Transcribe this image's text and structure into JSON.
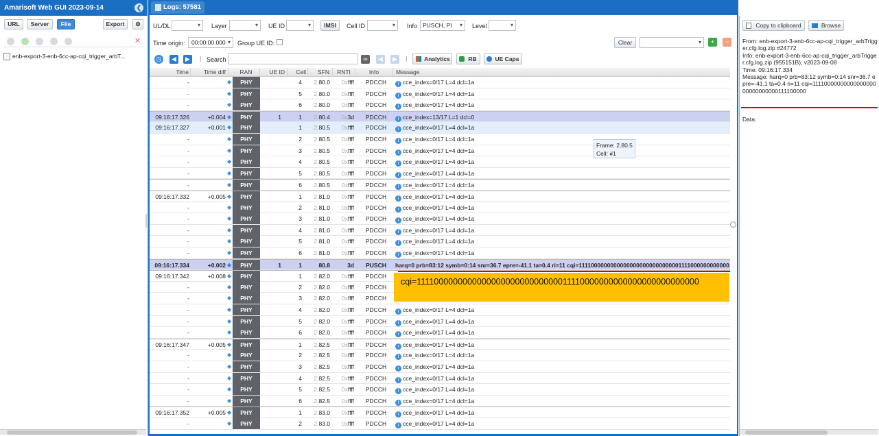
{
  "app": {
    "title": "Amarisoft Web GUI 2023-09-14"
  },
  "left": {
    "buttons": [
      "URL",
      "Server",
      "File",
      "Export"
    ],
    "tree_item": "enb-export-3-enb-6cc-ap-cqi_trigger_arbT..."
  },
  "main": {
    "tab_label": "Logs: 57581",
    "filters": {
      "uldl_label": "UL/DL",
      "uldl_value": "",
      "layer_label": "Layer",
      "layer_value": "",
      "ueid_label": "UE ID",
      "ueid_value": "",
      "imsi_button": "IMSI",
      "cellid_label": "Cell ID",
      "cellid_value": "",
      "info_label": "Info",
      "info_value": "PUSCH, PI",
      "level_label": "Level",
      "level_value": ""
    },
    "toolbar2": {
      "time_origin_label": "Time origin:",
      "time_origin_value": "00:00:00.000",
      "group_ueid_label": "Group UE ID:",
      "clear_button": "Clear",
      "clear_select_value": ""
    },
    "toolbar3": {
      "search_label": "Search",
      "analytics_button": "Analytics",
      "rb_button": "RB",
      "uecaps_button": "UE Caps"
    },
    "columns": [
      "Time",
      "Time diff",
      "RAN",
      "UE ID",
      "Cell",
      "SFN",
      "RNTI",
      "Info",
      "Message"
    ],
    "rows": [
      {
        "time": "-",
        "diff": "",
        "ran": "PHY",
        "ue": "",
        "cell": "4",
        "sfn_a": "2.",
        "sfn_b": "80.0",
        "rnti_a": "0x",
        "rnti_b": "ffff",
        "info": "PDCCH",
        "msg": "cce_index=0/17 L=4 dcl=1a",
        "style": ""
      },
      {
        "time": "-",
        "diff": "",
        "ran": "PHY",
        "ue": "",
        "cell": "5",
        "sfn_a": "2.",
        "sfn_b": "80.0",
        "rnti_a": "0x",
        "rnti_b": "ffff",
        "info": "PDCCH",
        "msg": "cce_index=0/17 L=4 dcl=1a",
        "style": ""
      },
      {
        "time": "-",
        "diff": "",
        "ran": "PHY",
        "ue": "",
        "cell": "6",
        "sfn_a": "2.",
        "sfn_b": "80.0",
        "rnti_a": "0x",
        "rnti_b": "ffff",
        "info": "PDCCH",
        "msg": "cce_index=0/17 L=4 dcl=1a",
        "style": ""
      },
      {
        "time": "09:16:17.326",
        "diff": "+0.004",
        "ran": "PHY",
        "ue": "1",
        "cell": "1",
        "sfn_a": "2.",
        "sfn_b": "80.4",
        "rnti_a": "0x",
        "rnti_b": "3d",
        "info": "PDCCH",
        "msg": "cce_index=13/17 L=1 dcl=0",
        "style": "hl sep"
      },
      {
        "time": "09:16:17.327",
        "diff": "+0.001",
        "ran": "PHY",
        "ue": "",
        "cell": "1",
        "sfn_a": "2.",
        "sfn_b": "80.5",
        "rnti_a": "0x",
        "rnti_b": "ffff",
        "info": "PDCCH",
        "msg": "cce_index=0/17 L=4 dcl=1a",
        "style": "hl2"
      },
      {
        "time": "-",
        "diff": "",
        "ran": "PHY",
        "ue": "",
        "cell": "2",
        "sfn_a": "2.",
        "sfn_b": "80.5",
        "rnti_a": "0x",
        "rnti_b": "ffff",
        "info": "PDCCH",
        "msg": "cce_index=0/17 L=4 dcl=1a",
        "style": ""
      },
      {
        "time": "-",
        "diff": "",
        "ran": "PHY",
        "ue": "",
        "cell": "3",
        "sfn_a": "2.",
        "sfn_b": "80.5",
        "rnti_a": "0x",
        "rnti_b": "ffff",
        "info": "PDCCH",
        "msg": "cce_index=0/17 L=4 dcl=1a",
        "style": ""
      },
      {
        "time": "-",
        "diff": "",
        "ran": "PHY",
        "ue": "",
        "cell": "4",
        "sfn_a": "2.",
        "sfn_b": "80.5",
        "rnti_a": "0x",
        "rnti_b": "ffff",
        "info": "PDCCH",
        "msg": "cce_index=0/17 L=4 dcl=1a",
        "style": ""
      },
      {
        "time": "-",
        "diff": "",
        "ran": "PHY",
        "ue": "",
        "cell": "5",
        "sfn_a": "2.",
        "sfn_b": "80.5",
        "rnti_a": "0x",
        "rnti_b": "ffff",
        "info": "PDCCH",
        "msg": "cce_index=0/17 L=4 dcl=1a",
        "style": ""
      },
      {
        "time": "-",
        "diff": "",
        "ran": "PHY",
        "ue": "",
        "cell": "6",
        "sfn_a": "2.",
        "sfn_b": "80.5",
        "rnti_a": "0x",
        "rnti_b": "ffff",
        "info": "PDCCH",
        "msg": "cce_index=0/17 L=4 dcl=1a",
        "style": "sep"
      },
      {
        "time": "09:16:17.332",
        "diff": "+0.005",
        "ran": "PHY",
        "ue": "",
        "cell": "1",
        "sfn_a": "2.",
        "sfn_b": "81.0",
        "rnti_a": "0x",
        "rnti_b": "ffff",
        "info": "PDCCH",
        "msg": "cce_index=0/17 L=4 dcl=1a",
        "style": "sep"
      },
      {
        "time": "-",
        "diff": "",
        "ran": "PHY",
        "ue": "",
        "cell": "2",
        "sfn_a": "2.",
        "sfn_b": "81.0",
        "rnti_a": "0x",
        "rnti_b": "ffff",
        "info": "PDCCH",
        "msg": "cce_index=0/17 L=4 dcl=1a",
        "style": ""
      },
      {
        "time": "-",
        "diff": "",
        "ran": "PHY",
        "ue": "",
        "cell": "3",
        "sfn_a": "2.",
        "sfn_b": "81.0",
        "rnti_a": "0x",
        "rnti_b": "ffff",
        "info": "PDCCH",
        "msg": "cce_index=0/17 L=4 dcl=1a",
        "style": ""
      },
      {
        "time": "-",
        "diff": "",
        "ran": "PHY",
        "ue": "",
        "cell": "4",
        "sfn_a": "2.",
        "sfn_b": "81.0",
        "rnti_a": "0x",
        "rnti_b": "ffff",
        "info": "PDCCH",
        "msg": "cce_index=0/17 L=4 dcl=1a",
        "style": ""
      },
      {
        "time": "-",
        "diff": "",
        "ran": "PHY",
        "ue": "",
        "cell": "5",
        "sfn_a": "2.",
        "sfn_b": "81.0",
        "rnti_a": "0x",
        "rnti_b": "ffff",
        "info": "PDCCH",
        "msg": "cce_index=0/17 L=4 dcl=1a",
        "style": ""
      },
      {
        "time": "-",
        "diff": "",
        "ran": "PHY",
        "ue": "",
        "cell": "6",
        "sfn_a": "2.",
        "sfn_b": "81.0",
        "rnti_a": "0x",
        "rnti_b": "ffff",
        "info": "PDCCH",
        "msg": "cce_index=0/17 L=4 dcl=1a",
        "style": ""
      },
      {
        "time": "09:16:17.334",
        "diff": "+0.002",
        "ran": "PHY",
        "ue": "1",
        "cell": "1",
        "sfn_a": "",
        "sfn_b": "80.8",
        "rnti_a": "",
        "rnti_b": "3d",
        "info": "PUSCH",
        "msg": "harq=0 prb=83:12 symb=0:14 snr=36.7 epre=-41.1 ta=0.4 ri=11 cqi=11110000000000000000000000000001111000000000000",
        "style": "hl bold sep"
      },
      {
        "time": "09:16:17.342",
        "diff": "+0.008",
        "ran": "PHY",
        "ue": "",
        "cell": "1",
        "sfn_a": "2.",
        "sfn_b": "82.0",
        "rnti_a": "0x",
        "rnti_b": "ffff",
        "info": "PDCCH",
        "msg": "",
        "style": "sep"
      },
      {
        "time": "-",
        "diff": "",
        "ran": "PHY",
        "ue": "",
        "cell": "2",
        "sfn_a": "2.",
        "sfn_b": "82.0",
        "rnti_a": "0x",
        "rnti_b": "ffff",
        "info": "PDCCH",
        "msg": "",
        "style": ""
      },
      {
        "time": "-",
        "diff": "",
        "ran": "PHY",
        "ue": "",
        "cell": "3",
        "sfn_a": "2.",
        "sfn_b": "82.0",
        "rnti_a": "0x",
        "rnti_b": "ffff",
        "info": "PDCCH",
        "msg": "",
        "style": ""
      },
      {
        "time": "-",
        "diff": "",
        "ran": "PHY",
        "ue": "",
        "cell": "4",
        "sfn_a": "2.",
        "sfn_b": "82.0",
        "rnti_a": "0x",
        "rnti_b": "ffff",
        "info": "PDCCH",
        "msg": "cce_index=0/17 L=4 dcl=1a",
        "style": ""
      },
      {
        "time": "-",
        "diff": "",
        "ran": "PHY",
        "ue": "",
        "cell": "5",
        "sfn_a": "2.",
        "sfn_b": "82.0",
        "rnti_a": "0x",
        "rnti_b": "ffff",
        "info": "PDCCH",
        "msg": "cce_index=0/17 L=4 dcl=1a",
        "style": ""
      },
      {
        "time": "-",
        "diff": "",
        "ran": "PHY",
        "ue": "",
        "cell": "6",
        "sfn_a": "2.",
        "sfn_b": "82.0",
        "rnti_a": "0x",
        "rnti_b": "ffff",
        "info": "PDCCH",
        "msg": "cce_index=0/17 L=4 dcl=1a",
        "style": ""
      },
      {
        "time": "09:16:17.347",
        "diff": "+0.005",
        "ran": "PHY",
        "ue": "",
        "cell": "1",
        "sfn_a": "2.",
        "sfn_b": "82.5",
        "rnti_a": "0x",
        "rnti_b": "ffff",
        "info": "PDCCH",
        "msg": "cce_index=0/17 L=4 dcl=1a",
        "style": "sep"
      },
      {
        "time": "-",
        "diff": "",
        "ran": "PHY",
        "ue": "",
        "cell": "2",
        "sfn_a": "2.",
        "sfn_b": "82.5",
        "rnti_a": "0x",
        "rnti_b": "ffff",
        "info": "PDCCH",
        "msg": "cce_index=0/17 L=4 dcl=1a",
        "style": ""
      },
      {
        "time": "-",
        "diff": "",
        "ran": "PHY",
        "ue": "",
        "cell": "3",
        "sfn_a": "2.",
        "sfn_b": "82.5",
        "rnti_a": "0x",
        "rnti_b": "ffff",
        "info": "PDCCH",
        "msg": "cce_index=0/17 L=4 dcl=1a",
        "style": ""
      },
      {
        "time": "-",
        "diff": "",
        "ran": "PHY",
        "ue": "",
        "cell": "4",
        "sfn_a": "2.",
        "sfn_b": "82.5",
        "rnti_a": "0x",
        "rnti_b": "ffff",
        "info": "PDCCH",
        "msg": "cce_index=0/17 L=4 dcl=1a",
        "style": ""
      },
      {
        "time": "-",
        "diff": "",
        "ran": "PHY",
        "ue": "",
        "cell": "5",
        "sfn_a": "2.",
        "sfn_b": "82.5",
        "rnti_a": "0x",
        "rnti_b": "ffff",
        "info": "PDCCH",
        "msg": "cce_index=0/17 L=4 dcl=1a",
        "style": ""
      },
      {
        "time": "-",
        "diff": "",
        "ran": "PHY",
        "ue": "",
        "cell": "6",
        "sfn_a": "2.",
        "sfn_b": "82.5",
        "rnti_a": "0x",
        "rnti_b": "ffff",
        "info": "PDCCH",
        "msg": "cce_index=0/17 L=4 dcl=1a",
        "style": ""
      },
      {
        "time": "09:16:17.352",
        "diff": "+0.005",
        "ran": "PHY",
        "ue": "",
        "cell": "1",
        "sfn_a": "2.",
        "sfn_b": "83.0",
        "rnti_a": "0x",
        "rnti_b": "ffff",
        "info": "PDCCH",
        "msg": "cce_index=0/17 L=4 dcl=1a",
        "style": "sep"
      },
      {
        "time": "-",
        "diff": "",
        "ran": "PHY",
        "ue": "",
        "cell": "2",
        "sfn_a": "2.",
        "sfn_b": "83.0",
        "rnti_a": "0x",
        "rnti_b": "ffff",
        "info": "PDCCH",
        "msg": "cce_index=0/17 L=4 dcl=1a",
        "style": ""
      }
    ],
    "tooltip": {
      "line1": "Frame: 2.80.5",
      "line2": "Cell: #1"
    },
    "callout_text": "cqi=111100000000000000000000000000011110000000000000000000000000"
  },
  "right": {
    "copy_button": "Copy to clipboard",
    "browse_button": "Browse",
    "details": [
      "From: enb-export-3-enb-6cc-ap-cqi_trigger_arbTrigger.cfg.log.zip #24772",
      "Info: enb-export-3-enb-6cc-ap-cqi_trigger_arbTrigger.cfg.log.zip (955151B), v2023-09-08",
      "Time: 09:16:17.334",
      "Message: harq=0 prb=83:12 symb=0:14 snr=36.7 epre=-41.1 ta=0.4 ri=11 cqi=1111000000000000000000000000000111100000"
    ],
    "data_label": "Data:"
  },
  "colors": {
    "header_blue": "#1a6fc4",
    "callout": "#ffc000",
    "selected_row": "#ccd1f1",
    "underline": "#e00000"
  }
}
